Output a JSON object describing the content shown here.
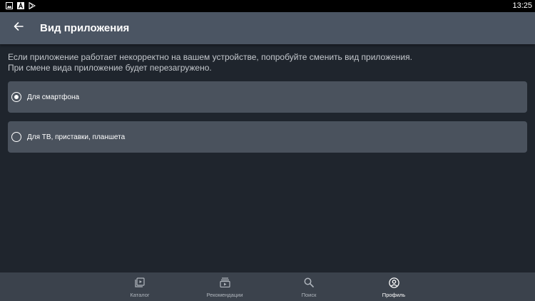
{
  "status_bar": {
    "time": "13:25",
    "icons": [
      "image-icon",
      "a-icon",
      "play-store-icon"
    ]
  },
  "app_bar": {
    "back_icon": "arrow-left-icon",
    "title": "Вид приложения"
  },
  "content": {
    "description_line1": "Если приложение работает некорректно на вашем устройстве, попробуйте сменить вид приложения.",
    "description_line2": "При смене вида приложение будет перезагружено.",
    "options": [
      {
        "label": "Для смартфона",
        "selected": true
      },
      {
        "label": "Для ТВ, приставки, планшета",
        "selected": false
      }
    ]
  },
  "bottom_nav": {
    "items": [
      {
        "label": "Каталог",
        "icon": "catalog-icon",
        "active": false
      },
      {
        "label": "Рекомендации",
        "icon": "recommendations-icon",
        "active": false
      },
      {
        "label": "Поиск",
        "icon": "search-icon",
        "active": false
      },
      {
        "label": "Профиль",
        "icon": "profile-icon",
        "active": true
      }
    ]
  },
  "colors": {
    "background": "#1f252d",
    "app_bar": "#4b5563",
    "option_card": "#4a525d",
    "bottom_nav": "#3b424c"
  }
}
